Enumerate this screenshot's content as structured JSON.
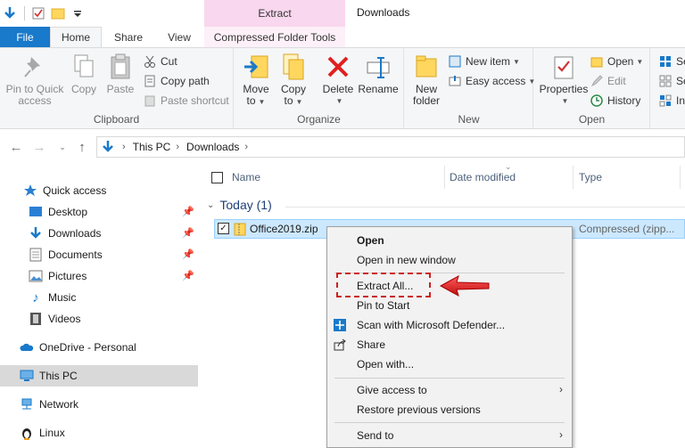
{
  "window": {
    "title": "Downloads",
    "context_tab_header": "Extract"
  },
  "tabs": {
    "file": "File",
    "home": "Home",
    "share": "Share",
    "view": "View",
    "compressed_folder_tools": "Compressed Folder Tools"
  },
  "ribbon": {
    "clipboard": {
      "label": "Clipboard",
      "pin_line1": "Pin to Quick",
      "pin_line2": "access",
      "copy": "Copy",
      "paste": "Paste",
      "cut": "Cut",
      "copy_path": "Copy path",
      "paste_shortcut": "Paste shortcut"
    },
    "organize": {
      "label": "Organize",
      "move_to_line1": "Move",
      "move_to_line2": "to",
      "copy_to_line1": "Copy",
      "copy_to_line2": "to",
      "delete": "Delete",
      "rename": "Rename"
    },
    "new": {
      "label": "New",
      "new_folder_line1": "New",
      "new_folder_line2": "folder",
      "new_item": "New item",
      "easy_access": "Easy access"
    },
    "open": {
      "label": "Open",
      "properties": "Properties",
      "open": "Open",
      "edit": "Edit",
      "history": "History"
    },
    "select_partial": [
      "Se",
      "Se",
      "In"
    ]
  },
  "address": {
    "crumbs": [
      "This PC",
      "Downloads"
    ]
  },
  "nav": {
    "quick_access": "Quick access",
    "desktop": "Desktop",
    "downloads": "Downloads",
    "documents": "Documents",
    "pictures": "Pictures",
    "music": "Music",
    "videos": "Videos",
    "onedrive": "OneDrive - Personal",
    "this_pc": "This PC",
    "network": "Network",
    "linux": "Linux"
  },
  "filelist": {
    "columns": {
      "name": "Name",
      "date_modified": "Date modified",
      "type": "Type"
    },
    "group": "Today (1)",
    "file": {
      "name": "Office2019.zip",
      "type": "Compressed (zipp..."
    }
  },
  "context_menu": {
    "open": "Open",
    "open_new_window": "Open in new window",
    "extract_all": "Extract All...",
    "pin_to_start": "Pin to Start",
    "scan_defender": "Scan with Microsoft Defender...",
    "share": "Share",
    "open_with": "Open with...",
    "give_access": "Give access to",
    "restore_versions": "Restore previous versions",
    "send_to": "Send to"
  },
  "colors": {
    "file_tab": "#1979ca",
    "context_tab": "#f9d7ee",
    "selection": "#cce8ff",
    "highlight_red": "#cc2020"
  }
}
